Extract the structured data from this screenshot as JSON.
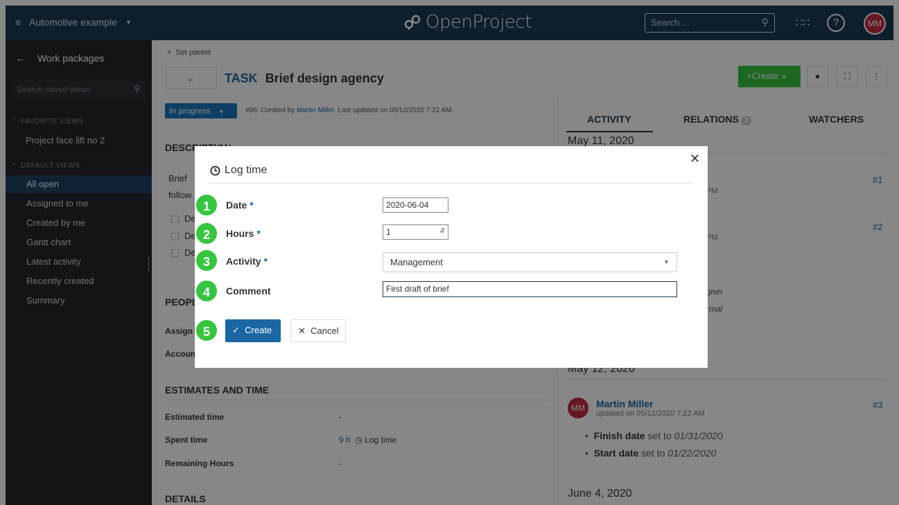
{
  "header": {
    "project": "Automotive example",
    "logo": "OpenProject",
    "search_placeholder": "Search ...",
    "avatar": "MM"
  },
  "sidebar": {
    "back_label": "Work packages",
    "search_placeholder": "Search saved views",
    "favorite_title": "FAVORITE VIEWS",
    "favorites": [
      "Project face lift no 2"
    ],
    "default_title": "DEFAULT VIEWS",
    "views": [
      "All open",
      "Assigned to me",
      "Created by me",
      "Gantt chart",
      "Latest activity",
      "Recently created",
      "Summary"
    ]
  },
  "workpackage": {
    "set_parent": "Set parent",
    "type": "TASK",
    "subject": "Brief design agency",
    "create_label": "Create",
    "status": "In progress",
    "meta_prefix": "#96: Created by ",
    "meta_author": "Martin Miller",
    "meta_suffix": ". Last updated on 05/12/2020 7:22 AM.",
    "description_title": "DESCRIPTION",
    "desc_frag1": "Brief ",
    "desc_frag2": "follow",
    "check_frag1": "De",
    "check_frag2": "De",
    "check_frag3": "De",
    "people_title": "PEOPLE",
    "assignee_frag": "Assign",
    "accountable_frag": "Accoun",
    "estimates_title": "ESTIMATES AND TIME",
    "estimated_label": "Estimated time",
    "estimated_value": "-",
    "spent_label": "Spent time",
    "spent_value": "9 h",
    "log_time_link": "Log time",
    "remaining_label": "Remaining Hours",
    "remaining_value": "-",
    "details_title": "DETAILS"
  },
  "activity": {
    "tabs": [
      "ACTIVITY",
      "RELATIONS",
      "WATCHERS"
    ],
    "relations_count": "2",
    "date1": "May 11, 2020",
    "num1": "#1",
    "num2": "#2",
    "frag_pm1": "PM",
    "frag_pm2": "PM",
    "frag_gner": "gner",
    "frag_rmal": "rmal",
    "date2": "May 12, 2020",
    "author_avatar": "MM",
    "author": "Martin Miller",
    "updated": "updated on 05/12/2020 7:22 AM",
    "num3": "#3",
    "change1_field": "Finish date",
    "change1_text": " set to ",
    "change1_val": "01/31/2020",
    "change2_field": "Start date",
    "change2_text": " set to ",
    "change2_val": "01/22/2020",
    "date3": "June 4, 2020"
  },
  "modal": {
    "title": "Log time",
    "steps": [
      "1",
      "2",
      "3",
      "4",
      "5"
    ],
    "date_label": "Date",
    "date_value": "2020-06-04",
    "hours_label": "Hours",
    "hours_value": "1",
    "activity_label": "Activity",
    "activity_value": "Management",
    "comment_label": "Comment",
    "comment_value": "First draft of brief",
    "required": "*",
    "create_label": "Create",
    "cancel_label": "Cancel"
  },
  "colors": {
    "header_bg": "#1a3954",
    "sidebar_bg": "#24272c",
    "accent_blue": "#1a67a3",
    "step_green": "#35c53f",
    "create_green": "#35c53f",
    "avatar_red": "#c42c3f"
  }
}
